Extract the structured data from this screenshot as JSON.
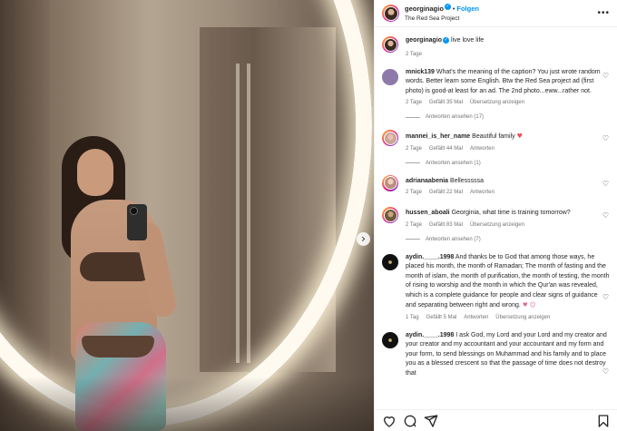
{
  "post": {
    "author": "georginagio",
    "follow_label": "Folgen",
    "separator": "•",
    "location": "The Red Sea Project",
    "caption_text": "live love life",
    "caption_time": "2 Tage",
    "next_icon": "chevron-right-icon",
    "more_icon": "more-horizontal-icon"
  },
  "comments": [
    {
      "user": "mnick139",
      "text": "What's the meaning of the caption? You just wrote random words. Better learn some English. Btw the Red Sea project ad (first photo) is good-at least for an ad. The 2nd photo...eww...rather not.",
      "time": "2 Tage",
      "likes": "Gefällt 35 Mal",
      "translate": "Übersetzung anzeigen",
      "replies": "Antworten ansehen (17)"
    },
    {
      "user": "mannei_is_her_name",
      "text": "Beautiful family",
      "emoji": "♥",
      "time": "2 Tage",
      "likes": "Gefällt 44 Mal",
      "reply": "Antworten",
      "replies": "Antworten ansehen (1)"
    },
    {
      "user": "adrianaabenia",
      "text": "Bellesssssa",
      "time": "2 Tage",
      "likes": "Gefällt 22 Mal",
      "reply": "Antworten"
    },
    {
      "user": "hussen_aboali",
      "text": "Georginia, what time is training tomorrow?",
      "time": "2 Tage",
      "likes": "Gefällt 83 Mal",
      "translate": "Übersetzung anzeigen",
      "replies": "Antworten ansehen (7)"
    },
    {
      "user": "aydin.____.1998",
      "text": "And thanks be to God that among those ways, he placed his month, the month of Ramadan; The month of fasting and the month of islam, the month of purification, the month of testing, the month of rising to worship and the month in which the Qur'an was revealed, which is a complete guidance for people and clear signs of guidance and separating between right and wrong.",
      "emoji": "♥ ☺",
      "time": "1 Tag",
      "likes": "Gefällt 5 Mal",
      "reply": "Antworten",
      "translate": "Übersetzung anzeigen"
    },
    {
      "user": "aydin.____.1998",
      "text": "I ask God, my Lord and your Lord and my creator and your creator and my accountant and your accountant and my form and your form, to send blessings on Muhammad and his family and to place you as a blessed crescent so that the passage of time does not destroy that"
    }
  ],
  "action_icons": [
    "heart-icon",
    "comment-icon",
    "share-icon",
    "bookmark-icon"
  ]
}
